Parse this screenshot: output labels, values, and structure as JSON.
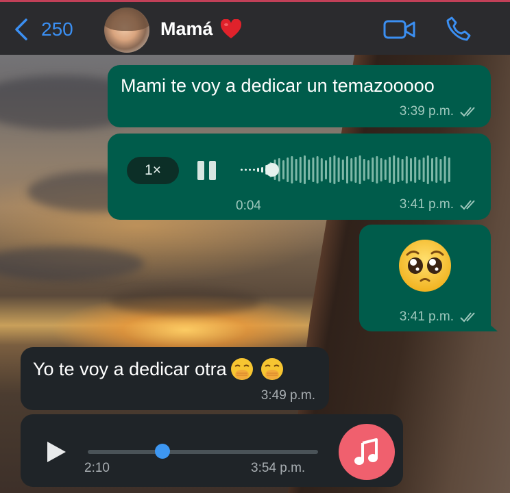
{
  "header": {
    "back_count": "250",
    "contact_name": "Mamá",
    "heart_icon": "red-heart-emoji",
    "accent_color": "#3b8ff2"
  },
  "messages": [
    {
      "direction": "outgoing",
      "type": "text",
      "text": "Mami te voy a dedicar un temazooooo",
      "time": "3:39 p.m.",
      "status": "read-double-check"
    },
    {
      "direction": "outgoing",
      "type": "voice",
      "speed": "1×",
      "duration": "0:04",
      "time": "3:41 p.m.",
      "status": "read-double-check",
      "state": "playing"
    },
    {
      "direction": "outgoing",
      "type": "emoji",
      "emoji": "pleading-face-emoji",
      "time": "3:41 p.m.",
      "status": "read-double-check"
    },
    {
      "direction": "incoming",
      "type": "text",
      "text": "Yo te voy a dedicar otra",
      "emojis": [
        "face-with-hand-over-mouth-emoji",
        "face-with-hand-over-mouth-emoji"
      ],
      "time": "3:49 p.m."
    },
    {
      "direction": "incoming",
      "type": "audio",
      "duration": "2:10",
      "time": "3:54 p.m.",
      "progress": 0.33,
      "icon": "music-note-icon"
    }
  ],
  "colors": {
    "outgoing_bubble": "#005c4b",
    "incoming_bubble": "#1f2428",
    "audio_thumb": "#f0606e",
    "progress_knob": "#3d97f2"
  }
}
